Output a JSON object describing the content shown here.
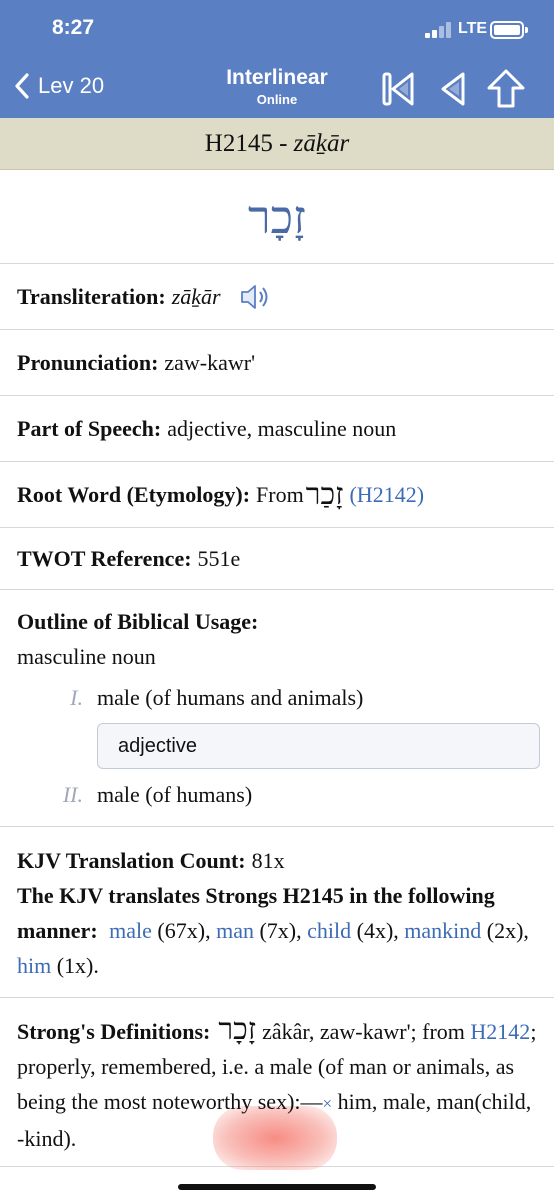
{
  "status": {
    "time": "8:27",
    "network": "LTE"
  },
  "nav": {
    "back_label": "Lev 20",
    "title": "Interlinear",
    "subtitle": "Online",
    "buttons": [
      "skip-to-start-icon",
      "previous-icon",
      "up-icon"
    ]
  },
  "header": {
    "code": "H2145 - ",
    "translit": "zāḵār"
  },
  "entry": {
    "hebrew": "זָכָר",
    "transliteration": {
      "label": "Transliteration:",
      "value": "zāḵār"
    },
    "pronunciation": {
      "label": "Pronunciation:",
      "value": "zaw-kawr'"
    },
    "part_of_speech": {
      "label": "Part of Speech:",
      "value": "adjective, masculine noun"
    },
    "root_word": {
      "label": "Root Word (Etymology):",
      "prefix": "From",
      "hebrew": "זָכַר",
      "ref": "(H2142)"
    },
    "twot": {
      "label": "TWOT Reference:",
      "value": "551e"
    },
    "outline": {
      "label": "Outline of Biblical Usage:",
      "heading": "masculine noun",
      "items": [
        {
          "num": "I.",
          "text": "male (of humans and animals)"
        },
        {
          "num": "II.",
          "text": "male (of humans)"
        }
      ],
      "box_text": "adjective"
    },
    "kjv": {
      "count_label": "KJV Translation Count:",
      "count_value": "81x",
      "manner_label": "The KJV translates Strongs H2145 in the following manner:",
      "items": [
        {
          "word": "male",
          "count": "(67x),"
        },
        {
          "word": "man",
          "count": "(7x),"
        },
        {
          "word": "child",
          "count": "(4x),"
        },
        {
          "word": "mankind",
          "count": "(2x),"
        },
        {
          "word": "him",
          "count": "(1x)."
        }
      ]
    },
    "strongs": {
      "label": "Strong's Definitions:",
      "hebrew": "זָכָר",
      "p1": "zâkâr, zaw-kawr';",
      "p2": "from",
      "ref": "H2142",
      "p3": "; properly, remembered, i.e. a male (of man or animals, as being the most noteworthy sex):—",
      "cross": "×",
      "p4": " him, male, man(child, -kind)."
    }
  }
}
